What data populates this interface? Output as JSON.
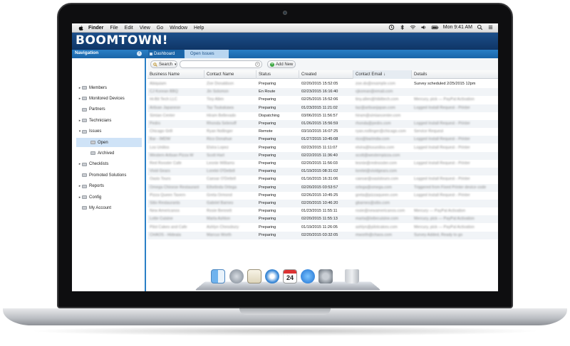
{
  "menubar": {
    "items": [
      "Finder",
      "File",
      "Edit",
      "View",
      "Go",
      "Window",
      "Help"
    ],
    "clock": "Mon 9:41 AM",
    "icons": [
      "apple-icon",
      "timemachine-icon",
      "bluetooth-icon",
      "wifi-icon",
      "volume-icon",
      "battery-icon",
      "search-icon",
      "list-icon"
    ]
  },
  "app": {
    "logo": "BOOMTOWN!",
    "nav_title": "Navigation",
    "tabs": [
      "Dashboard",
      "Open Issues"
    ]
  },
  "sidebar": {
    "items": [
      {
        "label": "Members",
        "arrow": "▸",
        "indent": 0
      },
      {
        "label": "Monitored Devices",
        "arrow": "▸",
        "indent": 0
      },
      {
        "label": "Partners",
        "arrow": "",
        "indent": 0
      },
      {
        "label": "Technicians",
        "arrow": "▸",
        "indent": 0
      },
      {
        "label": "Issues",
        "arrow": "▾",
        "indent": 0
      },
      {
        "label": "Open",
        "arrow": "",
        "indent": 1,
        "selected": true
      },
      {
        "label": "Archived",
        "arrow": "",
        "indent": 1
      },
      {
        "label": "Checklists",
        "arrow": "▸",
        "indent": 0
      },
      {
        "label": "Promoted Solutions",
        "arrow": "",
        "indent": 0
      },
      {
        "label": "Reports",
        "arrow": "▸",
        "indent": 0
      },
      {
        "label": "Config",
        "arrow": "▸",
        "indent": 0
      },
      {
        "label": "My Account",
        "arrow": "",
        "indent": 0
      }
    ]
  },
  "toolbar": {
    "search_label": "Search",
    "add_label": "Add New"
  },
  "table": {
    "columns": [
      "Business Name",
      "Contact Name",
      "Status",
      "Created",
      "Contact Email ↓",
      "Details"
    ],
    "rows": [
      {
        "business": "Abiquiam",
        "contact": "Zoe Donaldson",
        "status": "Preparing",
        "created": "02/20/2015 15:52:05",
        "email": "zoe.do@example.com",
        "details": "Survey scheduled 2/25/2015 12pm"
      },
      {
        "business": "CJ Korean BBQ",
        "contact": "Jin Solomon",
        "status": "En Route",
        "created": "02/23/2015 16:16:40",
        "email": "cjkorean@email.com",
        "details": ""
      },
      {
        "business": "Hi-Bit Tech LLC",
        "contact": "Tiny Allen",
        "status": "Preparing",
        "created": "02/25/2015 15:52:06",
        "email": "tiny.allen@hibittech.com",
        "details": "Mercury, pick — PayPal Activation"
      },
      {
        "business": "Artisan Japanese",
        "contact": "Taz Tsukakawa",
        "status": "Preparing",
        "created": "01/23/2015 11:21:02",
        "email": "taz@artisanjapan.com",
        "details": "Logged Install Request - Printer"
      },
      {
        "business": "Simian Center",
        "contact": "Hiram Bellevado",
        "status": "Dispatching",
        "created": "03/06/2015 11:56:57",
        "email": "hiram@simiancenter.com",
        "details": ""
      },
      {
        "business": "Pedro",
        "contact": "Rhonda Selenoff",
        "status": "Preparing",
        "created": "01/26/2015 15:56:59",
        "email": "rhonda@pedro.com",
        "details": "Logged Install Request - Printer"
      },
      {
        "business": "Chicago Grill",
        "contact": "Ryan Nollinger",
        "status": "Remote",
        "created": "03/10/2015 16:07:25",
        "email": "ryan.nollinger@chicago.com",
        "details": "Service Request"
      },
      {
        "business": "Bar - IMDW",
        "contact": "Rico Donahue",
        "status": "Preparing",
        "created": "01/27/2015 10:45:08",
        "email": "rico@barimdw.com",
        "details": "Logged Install Request - Printer"
      },
      {
        "business": "Los Uniilos",
        "contact": "Elvira Lopez",
        "status": "Preparing",
        "created": "02/23/2015 11:11:07",
        "email": "elvira@losuniilos.com",
        "details": "Logged Install Request - Printer"
      },
      {
        "business": "Western Artisan Pizza W",
        "contact": "Scott Hart",
        "status": "Preparing",
        "created": "02/22/2015 11:36:40",
        "email": "scott@westernpizza.com",
        "details": ""
      },
      {
        "business": "Red Rooster Cafe",
        "contact": "Leonie Williams",
        "status": "Preparing",
        "created": "02/20/2015 11:56:03",
        "email": "leonie@redrooster.com",
        "details": "Logged Install Request - Printer"
      },
      {
        "business": "Vivid Gears",
        "contact": "Lorelei O'Dettell",
        "status": "Preparing",
        "created": "01/19/2015 08:31:02",
        "email": "lorelei@vividgears.com",
        "details": ""
      },
      {
        "business": "Oasis Tours",
        "contact": "Caesar O'Dettell",
        "status": "Preparing",
        "created": "01/16/2015 16:31:06",
        "email": "caesar@oasistours.com",
        "details": "Logged Install Request - Printer"
      },
      {
        "business": "Omega Chinese Restaurant",
        "contact": "Ethelinda Ortega",
        "status": "Preparing",
        "created": "02/20/2015 03:53:57",
        "email": "ortega@omega.com",
        "details": "Triggered from Fixed Printer device code"
      },
      {
        "business": "Pizza Queen Tavern",
        "contact": "Greta Ormond",
        "status": "Preparing",
        "created": "02/26/2015 10:45:25",
        "email": "greta@pizzaqueen.com",
        "details": "Logged Install Request - Printer"
      },
      {
        "business": "Sitio Restaurants",
        "contact": "Gabriel Barnes",
        "status": "Preparing",
        "created": "02/20/2015 10:46:20",
        "email": "gbarnes@sitio.com",
        "details": ""
      },
      {
        "business": "New Americanos",
        "contact": "Rosie Bennett",
        "status": "Preparing",
        "created": "01/23/2015 11:55:11",
        "email": "rosie@newamericanos.com",
        "details": "Mercury — PayPal Activation"
      },
      {
        "business": "Lotte Cuisine",
        "contact": "Marta Ashton",
        "status": "Preparing",
        "created": "02/20/2015 11:55:13",
        "email": "marta@lottecuisine.com",
        "details": "Mercury, pick — PayPal Activation"
      },
      {
        "business": "Pilot Cakes and Cafe",
        "contact": "Ashlyn Chessbury",
        "status": "Preparing",
        "created": "01/19/2015 11:26:05",
        "email": "ashlyn@pilotcakes.com",
        "details": "Mercury, pick — PayPal Activation"
      },
      {
        "business": "CHAOS - Hideaia",
        "contact": "Marcus Worth",
        "status": "Preparing",
        "created": "02/20/2015 03:32:05",
        "email": "mworth@chaos.com",
        "details": "Survey Added, Ready to go"
      }
    ]
  },
  "dock": {
    "icons": [
      "finder-icon",
      "launchpad-icon",
      "textedit-icon",
      "safari-icon",
      "calendar-icon",
      "itunes-icon",
      "preferences-icon",
      "trash-icon"
    ],
    "calendar_day": "24"
  }
}
